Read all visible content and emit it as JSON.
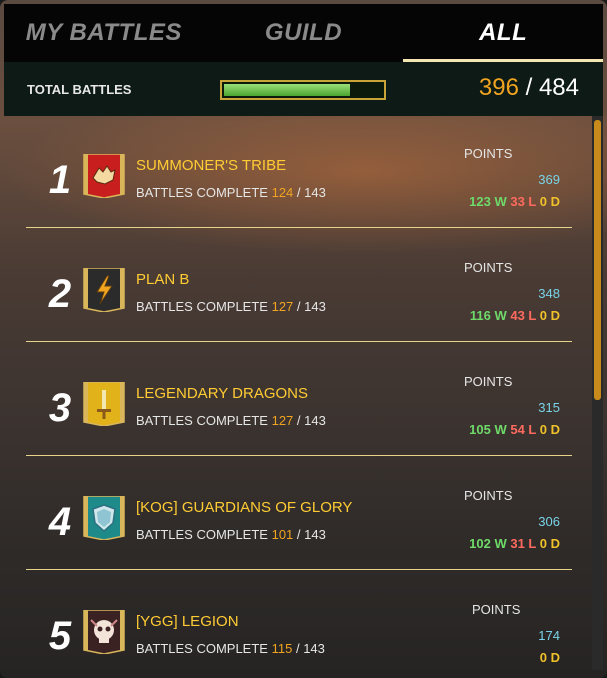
{
  "tabs": [
    {
      "label": "MY BATTLES",
      "active": false
    },
    {
      "label": "GUILD",
      "active": false
    },
    {
      "label": "ALL",
      "active": true
    }
  ],
  "totals": {
    "label": "TOTAL BATTLES",
    "completed": "396",
    "separator": "/",
    "total": "484",
    "progress_fraction": 0.818
  },
  "guilds": [
    {
      "rank": "1",
      "name": "SUMMONER'S TRIBE",
      "battles_label": "BATTLES COMPLETE",
      "done": "124",
      "sep": "/",
      "total": "143",
      "points_label": "POINTS",
      "points": "369",
      "w": "123 W",
      "l": "33 L",
      "d": "0 D",
      "banner_color": "#c81e1e",
      "emblem": "wolf-emblem-icon"
    },
    {
      "rank": "2",
      "name": "PLAN B",
      "battles_label": "BATTLES COMPLETE",
      "done": "127",
      "sep": "/",
      "total": "143",
      "points_label": "POINTS",
      "points": "348",
      "w": "116 W",
      "l": "43 L",
      "d": "0 D",
      "banner_color": "#2b2b2b",
      "emblem": "lightning-emblem-icon"
    },
    {
      "rank": "3",
      "name": "LEGENDARY DRAGONS",
      "battles_label": "BATTLES COMPLETE",
      "done": "127",
      "sep": "/",
      "total": "143",
      "points_label": "POINTS",
      "points": "315",
      "w": "105 W",
      "l": "54 L",
      "d": "0 D",
      "banner_color": "#e2b21a",
      "emblem": "sword-emblem-icon"
    },
    {
      "rank": "4",
      "name": "[KOG] GUARDIANS OF GLORY",
      "battles_label": "BATTLES COMPLETE",
      "done": "101",
      "sep": "/",
      "total": "143",
      "points_label": "POINTS",
      "points": "306",
      "w": "102 W",
      "l": "31 L",
      "d": "0 D",
      "banner_color": "#1e8a8a",
      "emblem": "shield-emblem-icon"
    },
    {
      "rank": "5",
      "name": "[YGG] LEGION",
      "battles_label": "BATTLES COMPLETE",
      "done": "115",
      "sep": "/",
      "total": "143",
      "points_label": "POINTS",
      "points": "174",
      "w": "",
      "l": "",
      "d": "0 D",
      "banner_color": "#3a2222",
      "emblem": "skull-emblem-icon"
    }
  ]
}
